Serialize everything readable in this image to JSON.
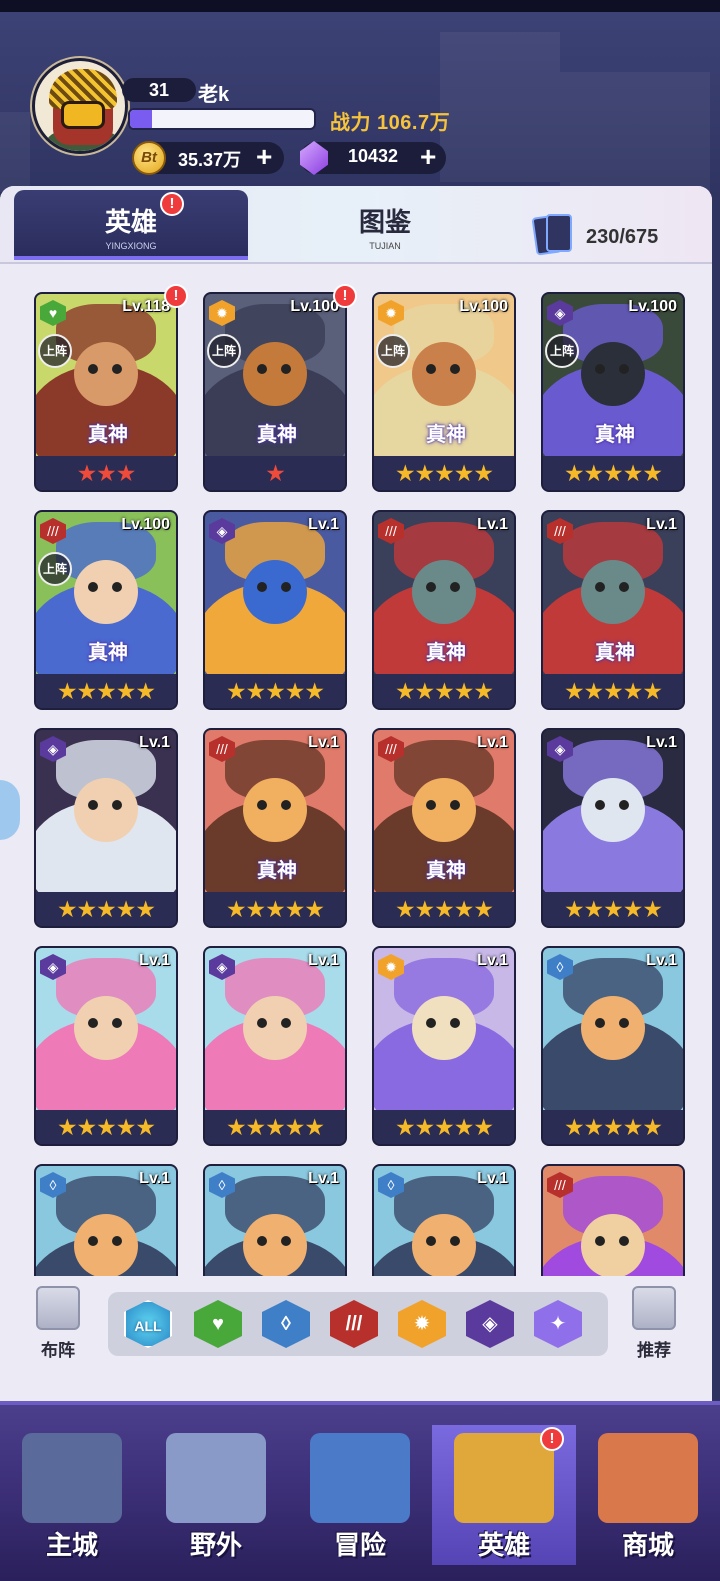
{
  "player": {
    "level": "31",
    "name": "老k",
    "power_label": "战力 106.7万",
    "xp_fraction": 0.12,
    "coins": "35.37万",
    "coin_symbol": "Bt",
    "gems": "10432",
    "plus": "+"
  },
  "tabs": [
    {
      "label": "英雄",
      "sub": "YINGXIONG",
      "active": true,
      "alert": "!"
    },
    {
      "label": "图鉴",
      "sub": "TUJIAN",
      "active": false
    }
  ],
  "card_count": "230/675",
  "deployed_label": "上阵",
  "rank_label": "真神",
  "heroes": [
    {
      "level": "Lv.118",
      "element": "nature",
      "stars": "★★★",
      "star_color": "red",
      "deployed": true,
      "rank": true,
      "alert": true
    },
    {
      "level": "Lv.100",
      "element": "light",
      "stars": "★",
      "star_color": "red",
      "deployed": true,
      "rank": true,
      "alert": true
    },
    {
      "level": "Lv.100",
      "element": "light",
      "stars": "★★★★★",
      "star_color": "gold",
      "deployed": true,
      "rank": true
    },
    {
      "level": "Lv.100",
      "element": "arcane",
      "stars": "★★★★★",
      "star_color": "gold",
      "deployed": true,
      "rank": true
    },
    {
      "level": "Lv.100",
      "element": "fire",
      "stars": "★★★★★",
      "star_color": "gold",
      "deployed": true,
      "rank": true
    },
    {
      "level": "Lv.1",
      "element": "arcane",
      "stars": "★★★★★",
      "star_color": "gold"
    },
    {
      "level": "Lv.1",
      "element": "fire",
      "stars": "★★★★★",
      "star_color": "gold",
      "rank": true
    },
    {
      "level": "Lv.1",
      "element": "fire",
      "stars": "★★★★★",
      "star_color": "gold",
      "rank": true
    },
    {
      "level": "Lv.1",
      "element": "arcane",
      "stars": "★★★★★",
      "star_color": "gold"
    },
    {
      "level": "Lv.1",
      "element": "fire",
      "stars": "★★★★★",
      "star_color": "gold",
      "rank": true
    },
    {
      "level": "Lv.1",
      "element": "fire",
      "stars": "★★★★★",
      "star_color": "gold",
      "rank": true
    },
    {
      "level": "Lv.1",
      "element": "arcane",
      "stars": "★★★★★",
      "star_color": "gold"
    },
    {
      "level": "Lv.1",
      "element": "arcane",
      "stars": "★★★★★",
      "star_color": "gold"
    },
    {
      "level": "Lv.1",
      "element": "arcane",
      "stars": "★★★★★",
      "star_color": "gold"
    },
    {
      "level": "Lv.1",
      "element": "light",
      "stars": "★★★★★",
      "star_color": "gold"
    },
    {
      "level": "Lv.1",
      "element": "water",
      "stars": "★★★★★",
      "star_color": "gold"
    },
    {
      "level": "Lv.1",
      "element": "water",
      "stars": "",
      "star_color": "gold"
    },
    {
      "level": "Lv.1",
      "element": "water",
      "stars": "",
      "star_color": "gold"
    },
    {
      "level": "Lv.1",
      "element": "water",
      "stars": "",
      "star_color": "gold"
    },
    {
      "level": "",
      "element": "fire",
      "stars": "",
      "star_color": "gold"
    }
  ],
  "element_colors": {
    "nature": "#49a83a",
    "light": "#f0a22a",
    "arcane": "#5a3a9c",
    "fire": "#b8302c",
    "water": "#3f7fc8",
    "star": "#9070ea"
  },
  "filters": {
    "left_label": "布阵",
    "right_label": "推荐",
    "all_label": "ALL",
    "items": [
      "nature",
      "water",
      "fire",
      "light",
      "arcane",
      "star"
    ]
  },
  "nav": [
    {
      "label": "主城",
      "icon": "city-icon",
      "active": false
    },
    {
      "label": "野外",
      "icon": "field-icon",
      "active": false
    },
    {
      "label": "冒险",
      "icon": "adventure-icon",
      "active": false
    },
    {
      "label": "英雄",
      "icon": "hero-icon",
      "active": true,
      "alert": "!"
    },
    {
      "label": "商城",
      "icon": "shop-icon",
      "active": false
    }
  ]
}
